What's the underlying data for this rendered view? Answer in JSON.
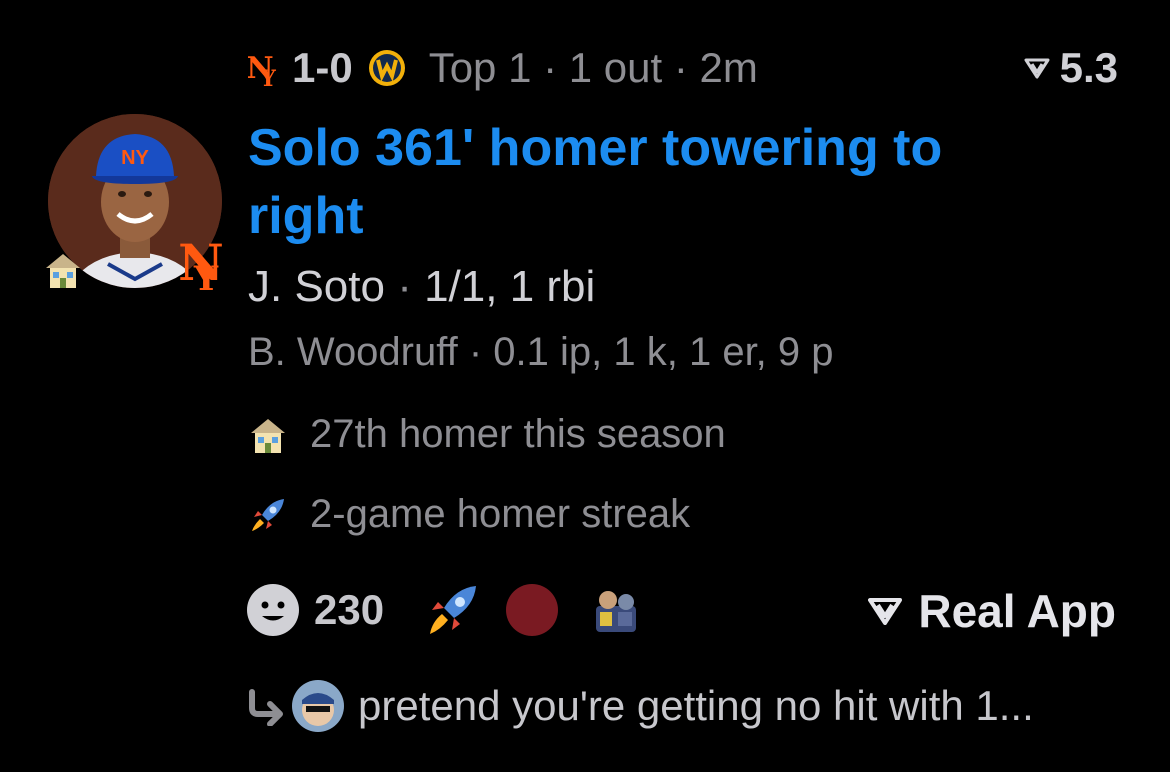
{
  "status": {
    "away_team_icon": "mets-logo-icon",
    "score": "1-0",
    "home_team_icon": "brewers-logo-icon",
    "game_state": "Top 1 · 1 out · 2m",
    "rating": "5.3"
  },
  "headline": "Solo 361' homer towering to right",
  "batter": {
    "name": "J. Soto",
    "separator": " · ",
    "stats": "1/1, 1 rbi"
  },
  "pitcher": {
    "line": "B. Woodruff · 0.1 ip, 1 k, 1 er, 9 p"
  },
  "facts": [
    {
      "icon": "house-icon",
      "text": "27th homer this season"
    },
    {
      "icon": "rocket-icon",
      "text": "2-game homer streak"
    }
  ],
  "reactions": {
    "count": "230",
    "icons": [
      "smiley-icon",
      "rocket-icon",
      "red-dot-icon",
      "toy-icon"
    ]
  },
  "real_app_label": "Real App",
  "reply": {
    "text": "pretend you're getting no hit with 1..."
  },
  "colors": {
    "accent": "#1c8cf0",
    "muted": "#8e8e93",
    "background": "#000000",
    "mets_orange": "#ff5910"
  }
}
